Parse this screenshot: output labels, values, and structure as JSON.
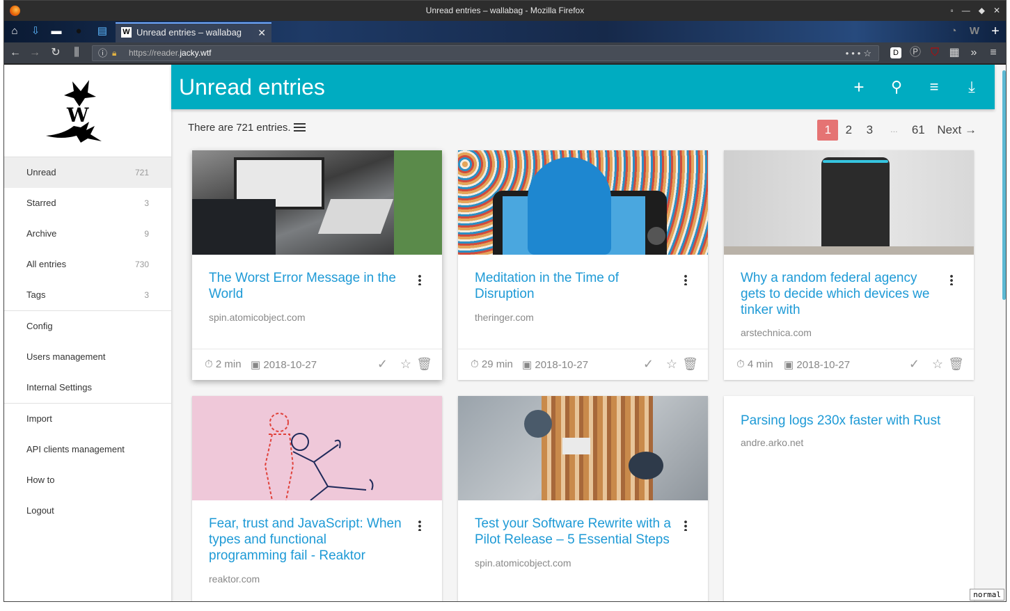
{
  "window": {
    "title": "Unread entries – wallabag - Mozilla Firefox"
  },
  "tab": {
    "title": "Unread entries – wallabag",
    "favicon": "W"
  },
  "url": {
    "scheme": "https://reader.",
    "host": "jacky.wtf"
  },
  "sidebar": {
    "items": [
      {
        "label": "Unread",
        "count": "721"
      },
      {
        "label": "Starred",
        "count": "3"
      },
      {
        "label": "Archive",
        "count": "9"
      },
      {
        "label": "All entries",
        "count": "730"
      },
      {
        "label": "Tags",
        "count": "3"
      }
    ],
    "config": [
      "Config",
      "Users management",
      "Internal Settings"
    ],
    "tools": [
      "Import",
      "API clients management",
      "How to",
      "Logout"
    ]
  },
  "header": {
    "title": "Unread entries"
  },
  "summary": {
    "text": "There are 721 entries."
  },
  "pager": {
    "pages": [
      "1",
      "2",
      "3"
    ],
    "dots": "…",
    "last": "61",
    "next": "Next →"
  },
  "cards": [
    {
      "title": "The Worst Error Message in the World",
      "domain": "spin.atomicobject.com",
      "time": "2 min",
      "date": "2018-10-27"
    },
    {
      "title": "Meditation in the Time of Disruption",
      "domain": "theringer.com",
      "time": "29 min",
      "date": "2018-10-27"
    },
    {
      "title": "Why a random federal agency gets to decide which devices we tinker with",
      "domain": "arstechnica.com",
      "time": "4 min",
      "date": "2018-10-27"
    },
    {
      "title": "Fear, trust and JavaScript: When types and functional programming fail - Reaktor",
      "domain": "reaktor.com"
    },
    {
      "title": "Test your Software Rewrite with a Pilot Release – 5 Essential Steps",
      "domain": "spin.atomicobject.com"
    },
    {
      "title": "Parsing logs 230x faster with Rust",
      "domain": "andre.arko.net"
    }
  ],
  "status": {
    "mode": "normal"
  },
  "colors": {
    "accent": "#00acc1",
    "link": "#1e9ad6",
    "current_page": "#e57373"
  }
}
